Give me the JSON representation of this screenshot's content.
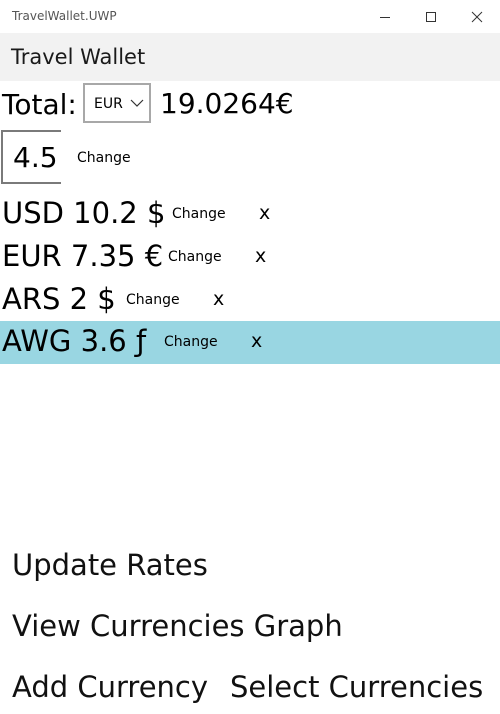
{
  "window": {
    "title": "TravelWallet.UWP"
  },
  "header": {
    "title": "Travel Wallet"
  },
  "total": {
    "label": "Total:",
    "currency": "EUR",
    "value": "19.0264€"
  },
  "amount": {
    "value": "4.5",
    "change_label": "Change"
  },
  "currencies": [
    {
      "label": "USD 10.2 $",
      "change_label": "Change",
      "remove_label": "x",
      "selected": false
    },
    {
      "label": "EUR 7.35 €",
      "change_label": "Change",
      "remove_label": "x",
      "selected": false
    },
    {
      "label": "ARS 2 $",
      "change_label": "Change",
      "remove_label": "x",
      "selected": false
    },
    {
      "label": "AWG 3.6 ƒ",
      "change_label": "Change",
      "remove_label": "x",
      "selected": true
    }
  ],
  "actions": {
    "update_rates": "Update Rates",
    "view_graph": "View Currencies Graph",
    "add_currency": "Add Currency",
    "select_currencies": "Select Currencies"
  },
  "colors": {
    "selected_row": "#99d6e2",
    "header_bg": "#f2f2f2"
  },
  "icons": {
    "minimize": "minimize-icon",
    "maximize": "maximize-icon",
    "close": "close-icon",
    "dropdown": "chevron-down-icon"
  }
}
